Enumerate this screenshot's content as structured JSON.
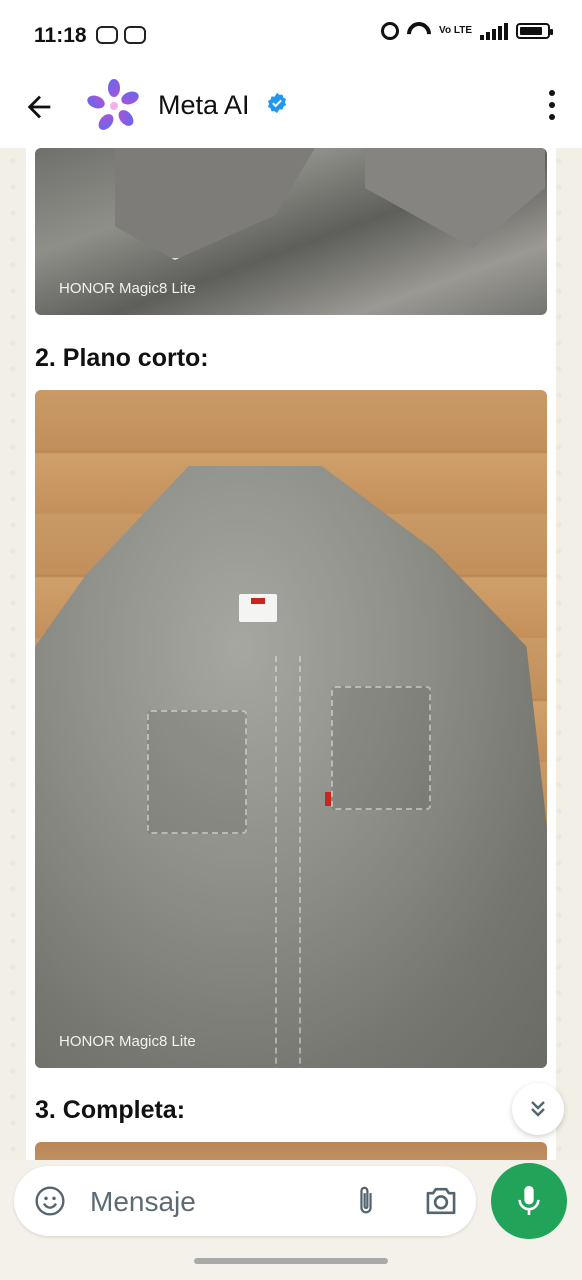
{
  "status_bar": {
    "time": "11:18",
    "network": "Vo LTE"
  },
  "header": {
    "title": "Meta AI",
    "verified": true
  },
  "chat": {
    "watermark": "HONOR Magic8 Lite",
    "section2_heading": "2. Plano corto:",
    "section3_heading": "3. Completa:"
  },
  "composer": {
    "placeholder": "Mensaje"
  },
  "colors": {
    "accent": "#21a35a",
    "verified": "#2196f3",
    "meta_gradient": [
      "#5b6cf0",
      "#b34fd6"
    ]
  },
  "icons": [
    "back-arrow-icon",
    "meta-ai-logo-icon",
    "verified-badge-icon",
    "more-options-icon",
    "scroll-down-icon",
    "emoji-icon",
    "paperclip-icon",
    "camera-icon",
    "mic-icon"
  ]
}
